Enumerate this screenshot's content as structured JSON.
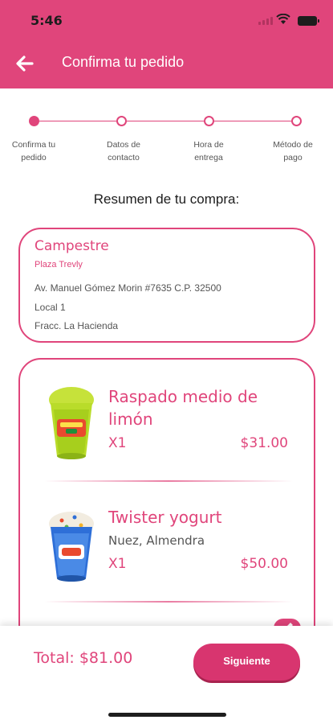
{
  "status_bar": {
    "time": "5:46"
  },
  "header": {
    "title": "Confirma tu pedido"
  },
  "stepper": {
    "steps": [
      {
        "label_line1": "Confirma tu",
        "label_line2": "pedido",
        "active": true
      },
      {
        "label_line1": "Datos de",
        "label_line2": "contacto",
        "active": false
      },
      {
        "label_line1": "Hora de",
        "label_line2": "entrega",
        "active": false
      },
      {
        "label_line1": "Método de",
        "label_line2": "pago",
        "active": false
      }
    ]
  },
  "summary": {
    "title": "Resumen de tu compra:"
  },
  "store": {
    "name": "Campestre",
    "subtitle": "Plaza Trevly",
    "address_line1": "Av. Manuel Gómez Morin #7635 C.P. 32500",
    "address_line2": "Local 1",
    "address_line3": "Fracc. La Hacienda"
  },
  "items": [
    {
      "name": "Raspado medio de limón",
      "description": "",
      "quantity": "X1",
      "price": "$31.00",
      "icon": "raspado-cup-icon"
    },
    {
      "name": "Twister yogurt",
      "description": "Nuez, Almendra",
      "quantity": "X1",
      "price": "$50.00",
      "icon": "twister-cup-icon"
    }
  ],
  "footer": {
    "total": "Total: $81.00",
    "next_label": "Siguiente"
  },
  "colors": {
    "accent": "#e0457b",
    "button": "#d8356f"
  }
}
